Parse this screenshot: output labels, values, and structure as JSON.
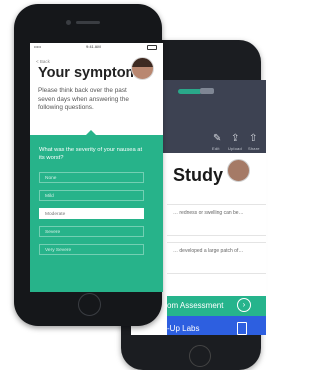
{
  "back_app": {
    "header_icons": [
      {
        "icon": "edit-icon",
        "glyph": "✎",
        "label": "Edit"
      },
      {
        "icon": "upload-icon",
        "glyph": "⇪",
        "label": "Upload"
      },
      {
        "icon": "share-icon",
        "glyph": "⇧",
        "label": "Share"
      }
    ],
    "title": "Study",
    "cards": [
      "… redness or swelling can be…",
      "… developed a large patch of…"
    ],
    "assessment_label": "om Assessment",
    "labs_label": "-Up Labs"
  },
  "front_app": {
    "status": {
      "carrier": "•••••",
      "time": "9:41 AM"
    },
    "nav_back_label": "< Back",
    "title": "Your symptoms.",
    "subtitle": "Please think back over the past seven days when answering the following questions.",
    "question": "What was the severity of your nausea at its worst?",
    "options": [
      {
        "label": "None",
        "selected": false
      },
      {
        "label": "Mild",
        "selected": false
      },
      {
        "label": "Moderate",
        "selected": true
      },
      {
        "label": "Severe",
        "selected": false
      },
      {
        "label": "Very Severe",
        "selected": false
      }
    ]
  },
  "colors": {
    "accent_green": "#27b38a",
    "assessment_green": "#26b48c",
    "labs_blue": "#2d5fe0",
    "header_navy": "#3d4252"
  }
}
